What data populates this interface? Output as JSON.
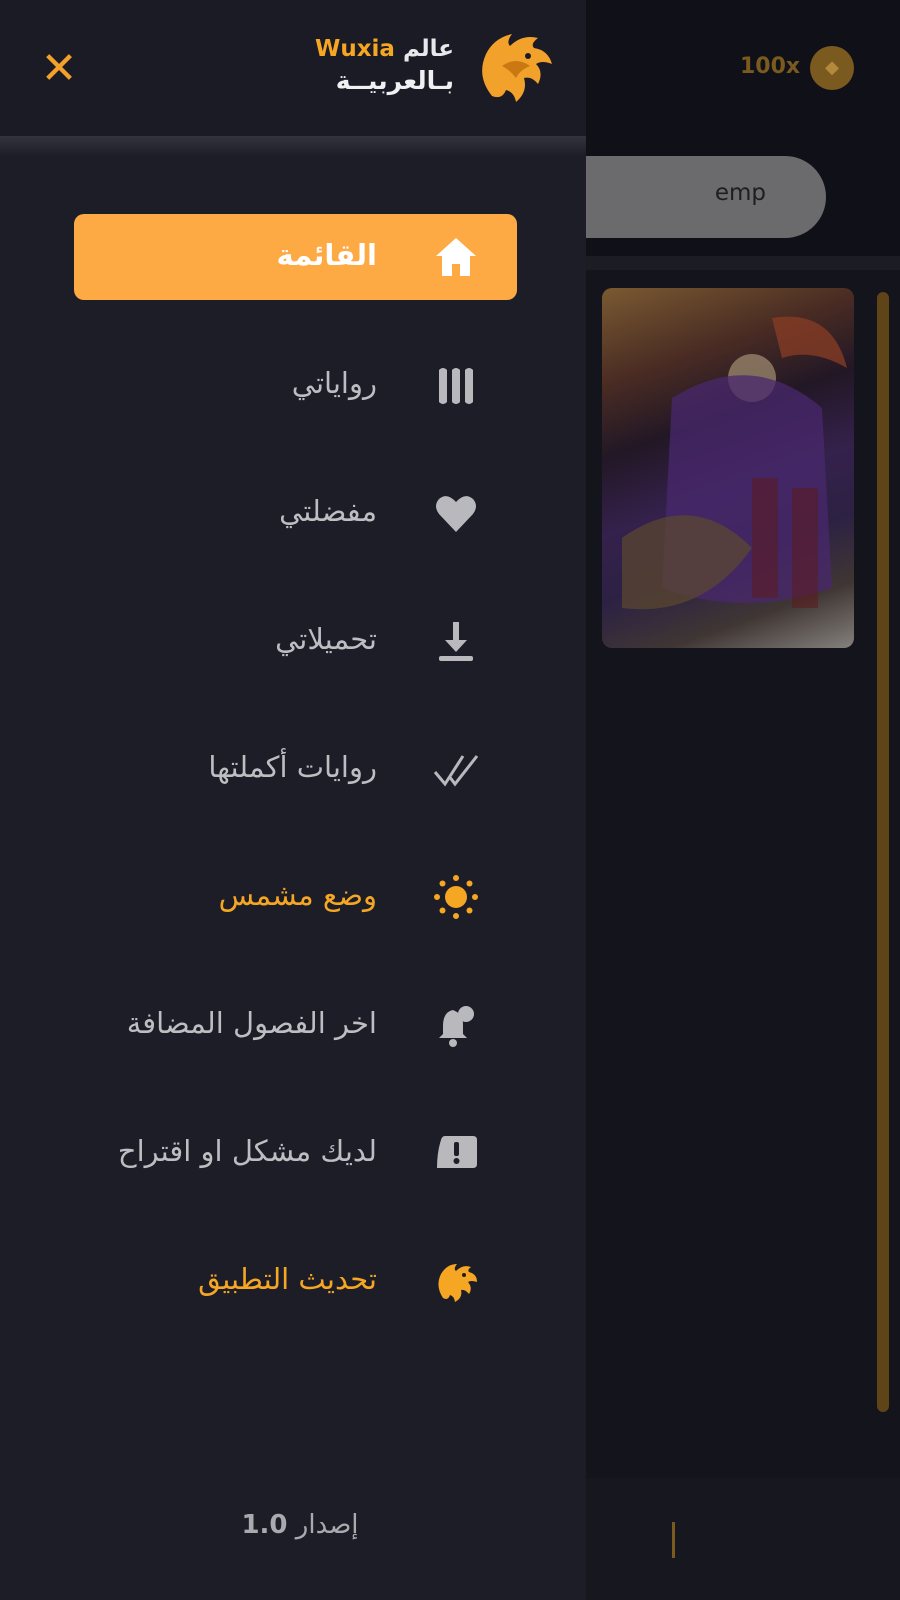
{
  "background": {
    "coin_count": "100x",
    "coin_icon": "coin-icon",
    "search_text": "emp"
  },
  "drawer": {
    "close_icon": "close-icon",
    "logo": {
      "word_world": "عالم",
      "word_wuxia": "Wuxia",
      "subtitle": "بـالعربيــة"
    },
    "menu": [
      {
        "label": "القائمة",
        "icon": "home-icon",
        "active": true
      },
      {
        "label": "رواياتي",
        "icon": "books-icon"
      },
      {
        "label": "مفضلتي",
        "icon": "heart-icon"
      },
      {
        "label": "تحميلاتي",
        "icon": "download-icon"
      },
      {
        "label": "روايات أكملتها",
        "icon": "double-check-icon"
      },
      {
        "label": "وضع مشمس",
        "icon": "sun-icon",
        "accent": true
      },
      {
        "label": "اخر الفصول المضافة",
        "icon": "bell-icon"
      },
      {
        "label": "لديك مشكل او اقتراح",
        "icon": "alert-icon"
      },
      {
        "label": "تحديث التطبيق",
        "icon": "dragon-icon",
        "accent": true
      }
    ],
    "version_label": "إصدار",
    "version_number": "1.0"
  },
  "colors": {
    "accent": "#f5a623",
    "active_bg": "#fdaa44",
    "drawer_bg": "#1d1d28"
  }
}
